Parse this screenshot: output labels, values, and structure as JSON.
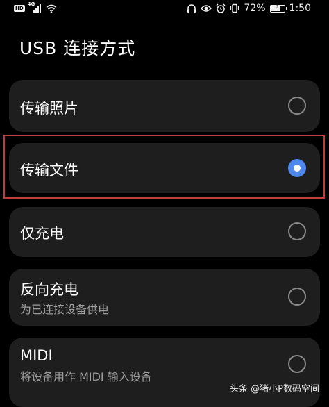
{
  "status_bar": {
    "hd_badge": "HD",
    "network": "4G",
    "battery_percent": "72%",
    "battery_level": 0.72,
    "time": "1:50",
    "icons": [
      "wifi-icon",
      "headphones-icon",
      "eye-icon",
      "alarm-icon",
      "vibrate-icon",
      "battery-icon"
    ]
  },
  "page": {
    "title": "USB 连接方式"
  },
  "options": [
    {
      "label": "传输照片",
      "sublabel": "",
      "selected": false
    },
    {
      "label": "传输文件",
      "sublabel": "",
      "selected": true
    },
    {
      "label": "仅充电",
      "sublabel": "",
      "selected": false
    },
    {
      "label": "反向充电",
      "sublabel": "为已连接设备供电",
      "selected": false
    },
    {
      "label": "MIDI",
      "sublabel": "将设备用作 MIDI 输入设备",
      "selected": false
    }
  ],
  "watermark": {
    "text": "头条 @猪小P数码空间"
  },
  "colors": {
    "background": "#000000",
    "card": "#1e1e1e",
    "accent": "#4e88ee",
    "highlight": "#c43a3a"
  }
}
